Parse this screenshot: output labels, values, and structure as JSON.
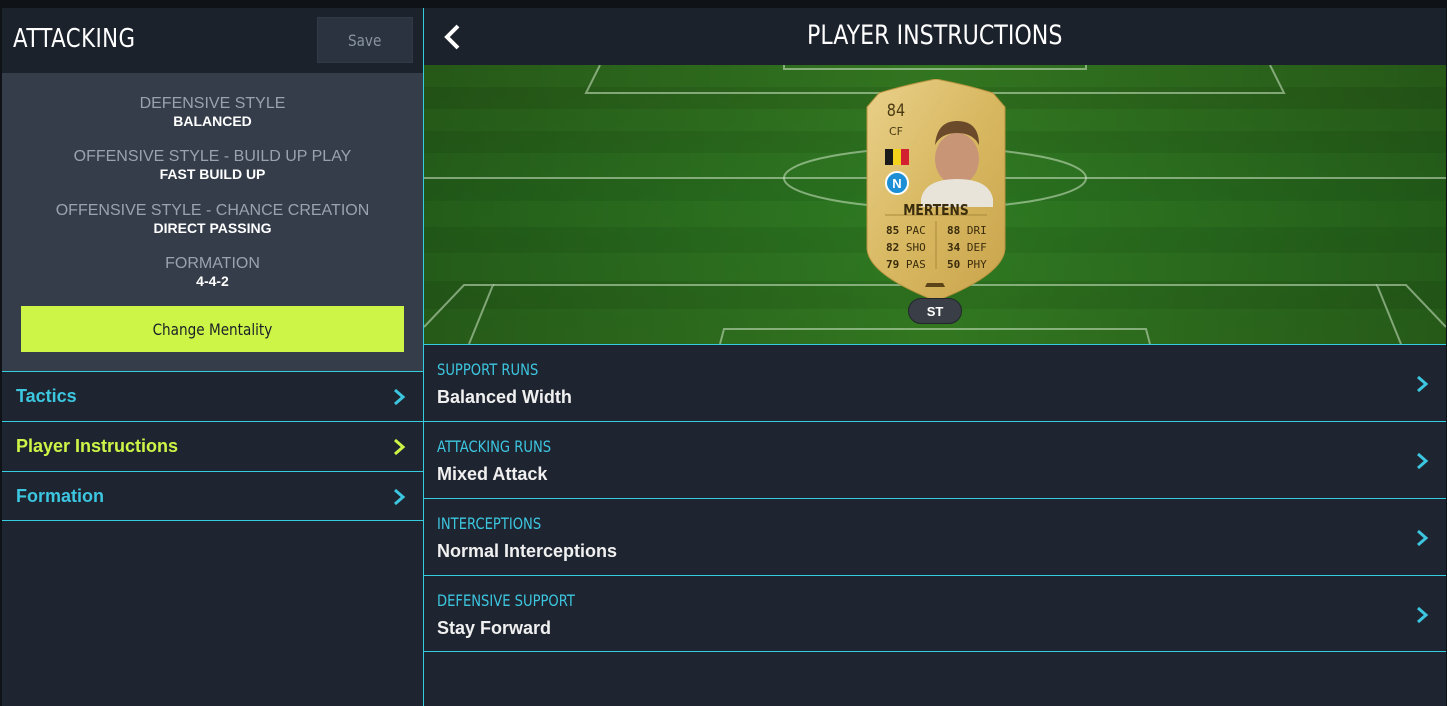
{
  "left": {
    "title": "ATTACKING",
    "save_label": "Save",
    "summary": [
      {
        "label": "DEFENSIVE STYLE",
        "value": "BALANCED"
      },
      {
        "label": "OFFENSIVE STYLE - BUILD UP PLAY",
        "value": "FAST BUILD UP"
      },
      {
        "label": "OFFENSIVE STYLE - CHANCE CREATION",
        "value": "DIRECT PASSING"
      },
      {
        "label": "FORMATION",
        "value": "4-4-2"
      }
    ],
    "mentality_button": "Change Mentality",
    "nav": [
      {
        "label": "Tactics",
        "icon": "chevron-right-icon",
        "active": false
      },
      {
        "label": "Player Instructions",
        "icon": "chevron-right-icon",
        "active": true
      },
      {
        "label": "Formation",
        "icon": "chevron-right-icon",
        "active": false
      }
    ]
  },
  "right": {
    "title": "PLAYER INSTRUCTIONS",
    "back_icon": "chevron-left-icon",
    "card": {
      "rating": "84",
      "position": "CF",
      "name": "MERTENS",
      "nation_flag": "belgium-flag-icon",
      "club_badge": "napoli-badge-icon",
      "stats": {
        "pac": "85",
        "pac_label": "PAC",
        "sho": "82",
        "sho_label": "SHO",
        "pas": "79",
        "pas_label": "PAS",
        "dri": "88",
        "dri_label": "DRI",
        "def": "34",
        "def_label": "DEF",
        "phy": "50",
        "phy_label": "PHY"
      },
      "slot_position": "ST"
    },
    "instructions": [
      {
        "label": "SUPPORT RUNS",
        "value": "Balanced Width"
      },
      {
        "label": "ATTACKING RUNS",
        "value": "Mixed Attack"
      },
      {
        "label": "INTERCEPTIONS",
        "value": "Normal Interceptions"
      },
      {
        "label": "DEFENSIVE SUPPORT",
        "value": "Stay Forward"
      }
    ]
  },
  "colors": {
    "accent_cyan": "#34cde0",
    "accent_lime": "#cdf547",
    "panel": "#1f2530",
    "summary_bg": "#353d4a"
  }
}
